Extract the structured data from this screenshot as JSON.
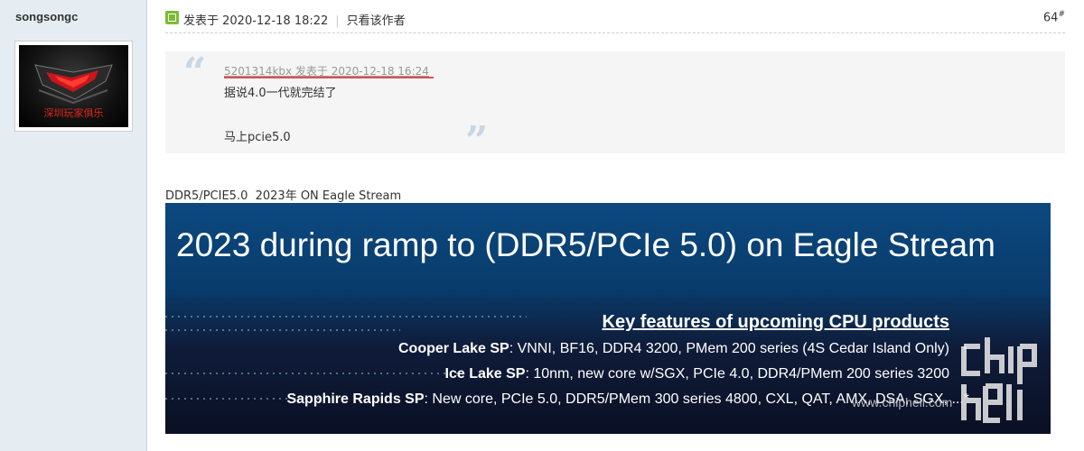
{
  "author": {
    "name": "songsongc",
    "avatar_caption": "深圳玩家俱乐"
  },
  "post": {
    "posted_at": "发表于 2020-12-18 18:22",
    "only_author_label": "只看该作者",
    "floor_number": "64",
    "floor_mark": "#"
  },
  "quote": {
    "source": "5201314kbx 发表于 2020-12-18 16:24",
    "line1": "据说4.0一代就完结了",
    "line2": "马上pcie5.0"
  },
  "body_text": "DDR5/PCIE5.0  2023年 ON Eagle Stream",
  "slide": {
    "title": "2023 during ramp to (DDR5/PCIe 5.0) on Eagle Stream",
    "heading": "Key features of upcoming CPU products",
    "features": [
      {
        "name": "Cooper Lake SP",
        "desc": ":  VNNI, BF16, DDR4 3200, PMem 200 series (4S Cedar Island Only)"
      },
      {
        "name": "Ice Lake SP",
        "desc": ":  10nm, new core w/SGX, PCIe 4.0, DDR4/PMem 200 series 3200"
      },
      {
        "name": "Sapphire Rapids SP",
        "desc": ":  New core, PCIe 5.0, DDR5/PMem 300 series 4800, CXL, QAT, AMX, DSA, SGX, ...*"
      }
    ],
    "watermark_url": "www.chiphell.com",
    "watermark_logo": "chip hell"
  },
  "colors": {
    "sidebar_bg": "#e5edf2",
    "quote_bg": "#f5f5f5",
    "post_icon": "#7cbc33",
    "slide_top": "#0a3f70",
    "slide_bottom": "#0a1024"
  }
}
